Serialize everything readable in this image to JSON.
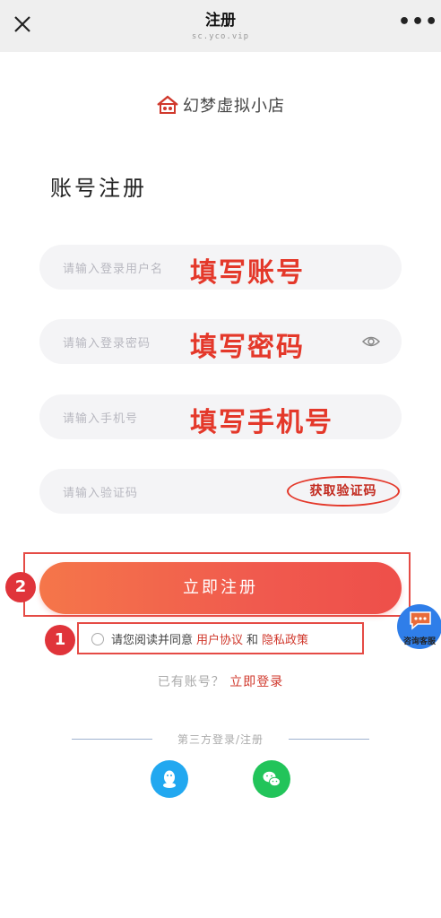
{
  "topbar": {
    "title": "注册",
    "subtitle": "sc.yco.vip"
  },
  "logo": {
    "text": "幻梦虚拟小店"
  },
  "page_title": "账号注册",
  "fields": {
    "username": {
      "placeholder": "请输入登录用户名",
      "annotation": "填写账号"
    },
    "password": {
      "placeholder": "请输入登录密码",
      "annotation": "填写密码"
    },
    "phone": {
      "placeholder": "请输入手机号",
      "annotation": "填写手机号"
    },
    "code": {
      "placeholder": "请输入验证码",
      "button": "获取验证码"
    }
  },
  "register_button": "立即注册",
  "badges": {
    "step1": "1",
    "step2": "2"
  },
  "agreement": {
    "prefix": "请您阅读并同意",
    "user_agreement": "用户协议",
    "and": "和",
    "privacy_policy": "隐私政策"
  },
  "customer_service": {
    "label": "咨询客服"
  },
  "login_prompt": {
    "text": "已有账号？",
    "link": "立即登录"
  },
  "third_party": {
    "label": "第三方登录/注册"
  },
  "colors": {
    "accent": "#f05a4e",
    "annotation_red": "#e4382a",
    "qq": "#22a8f0",
    "wechat": "#22c45a"
  },
  "icons": [
    "close-icon",
    "more-icon",
    "store-logo-icon",
    "eye-icon",
    "chat-icon",
    "qq-icon",
    "wechat-icon"
  ]
}
